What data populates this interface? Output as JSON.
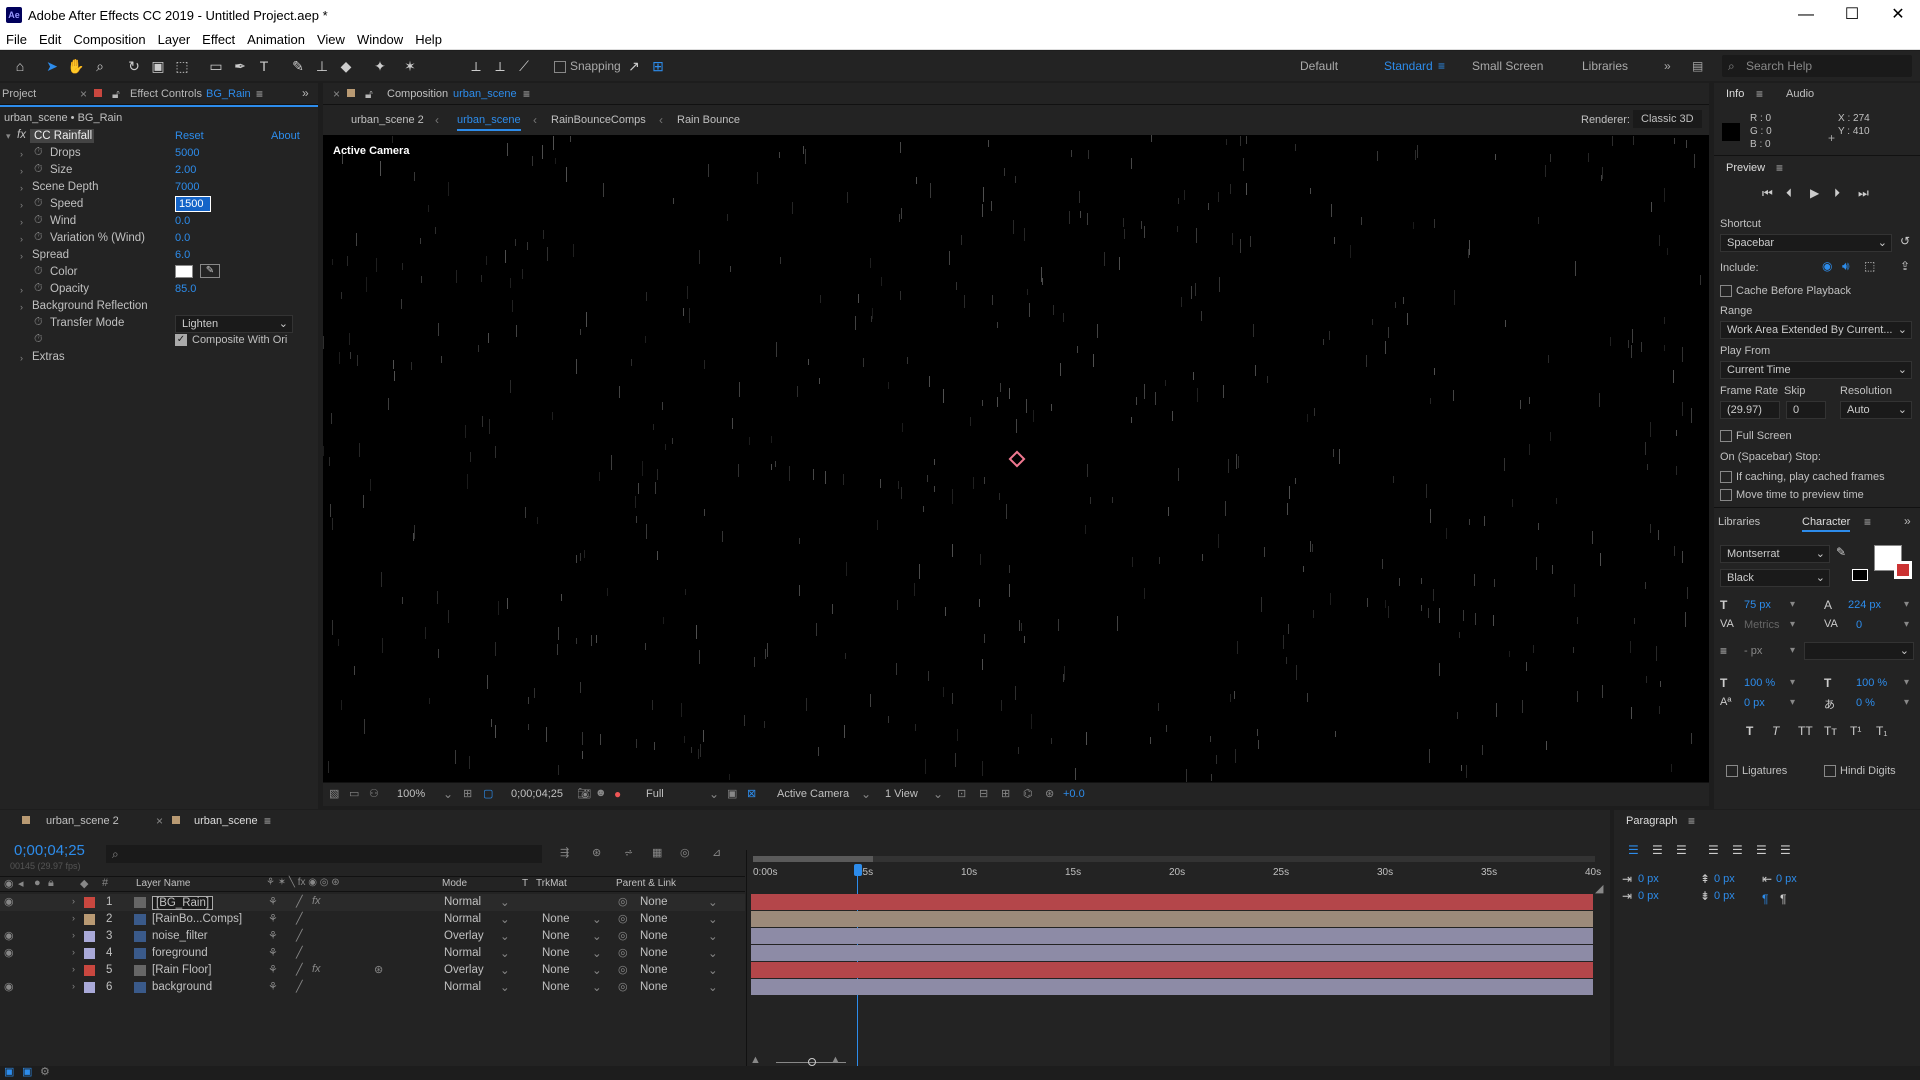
{
  "window": {
    "title": "Adobe After Effects CC 2019 - Untitled Project.aep *",
    "min": "—",
    "max": "☐",
    "close": "✕"
  },
  "menu": [
    "File",
    "Edit",
    "Composition",
    "Layer",
    "Effect",
    "Animation",
    "View",
    "Window",
    "Help"
  ],
  "toolbar": {
    "snapping": "Snapping",
    "workspaces": [
      "Default",
      "Standard",
      "Small Screen",
      "Libraries"
    ],
    "search": "Search Help"
  },
  "left_panel": {
    "tab_project": "Project",
    "tab_effect": "Effect Controls",
    "effect_layer": "BG_Rain",
    "subtitle": "urban_scene • BG_Rain",
    "fx_name": "CC Rainfall",
    "reset": "Reset",
    "about": "About",
    "props": [
      {
        "name": "Drops",
        "value": "5000"
      },
      {
        "name": "Size",
        "value": "2.00"
      },
      {
        "name": "Scene Depth",
        "value": "7000"
      },
      {
        "name": "Speed",
        "value": "1500"
      },
      {
        "name": "Wind",
        "value": "0.0"
      },
      {
        "name": "Variation % (Wind)",
        "value": "0.0"
      },
      {
        "name": "Spread",
        "value": "6.0"
      },
      {
        "name": "Color",
        "value": ""
      },
      {
        "name": "Opacity",
        "value": "85.0"
      },
      {
        "name": "Background Reflection",
        "value": ""
      },
      {
        "name": "Transfer Mode",
        "value": "Lighten"
      },
      {
        "name": "",
        "value": "Composite With Ori"
      },
      {
        "name": "Extras",
        "value": ""
      }
    ]
  },
  "comp_panel": {
    "tab": "Composition",
    "comp": "urban_scene",
    "breadcrumbs": [
      "urban_scene 2",
      "urban_scene",
      "RainBounceComps",
      "Rain Bounce"
    ],
    "renderer_label": "Renderer:",
    "renderer": "Classic 3D",
    "view_label": "Active Camera",
    "bottom": {
      "zoom": "100%",
      "time": "0;00;04;25",
      "res": "Full",
      "camera": "Active Camera",
      "views": "1 View",
      "exposure": "+0.0"
    }
  },
  "info": {
    "tab": "Info",
    "tab2": "Audio",
    "r": "R : 0",
    "g": "G : 0",
    "b": "B : 0",
    "x": "X : 274",
    "y": "Y : 410"
  },
  "preview": {
    "title": "Preview",
    "shortcut_label": "Shortcut",
    "shortcut": "Spacebar",
    "include": "Include:",
    "cache": "Cache Before Playback",
    "range_label": "Range",
    "range": "Work Area Extended By Current...",
    "play_from_label": "Play From",
    "play_from": "Current Time",
    "fr_label": "Frame Rate",
    "skip_label": "Skip",
    "res_label": "Resolution",
    "fr": "(29.97)",
    "skip": "0",
    "res": "Auto",
    "fullscreen": "Full Screen",
    "stop_label": "On (Spacebar) Stop:",
    "opt1": "If caching, play cached frames",
    "opt2": "Move time to preview time"
  },
  "character": {
    "tab1": "Libraries",
    "tab2": "Character",
    "font": "Montserrat",
    "style": "Black",
    "size": "75 px",
    "leading": "224 px",
    "kerning": "Metrics",
    "tracking": "0",
    "stroke": "- px",
    "vscale": "100 %",
    "hscale": "100 %",
    "baseline": "0 px",
    "tsume": "0 %",
    "ligatures": "Ligatures",
    "hindi": "Hindi Digits",
    "styles": [
      "T",
      "T",
      "TT",
      "Tт",
      "T¹",
      "T₁"
    ]
  },
  "paragraph": {
    "title": "Paragraph",
    "v1": "0 px",
    "v2": "0 px",
    "v3": "0 px",
    "v4": "0 px",
    "v5": "0 px"
  },
  "timeline": {
    "tabs": [
      "urban_scene 2",
      "urban_scene"
    ],
    "timecode": "0;00;04;25",
    "fps": "00145 (29.97 fps)",
    "cols": {
      "name": "Layer Name",
      "mode": "Mode",
      "t": "T",
      "trkmat": "TrkMat",
      "parent": "Parent & Link"
    },
    "ruler": [
      "0:00s",
      "05s",
      "10s",
      "15s",
      "20s",
      "25s",
      "30s",
      "35s",
      "40s"
    ],
    "layers": [
      {
        "num": "1",
        "name": "[BG_Rain]",
        "mode": "Normal",
        "trk": "",
        "parent": "None",
        "color": "#c9473f",
        "bar": "#b4464a"
      },
      {
        "num": "2",
        "name": "[RainBo...Comps]",
        "mode": "Normal",
        "trk": "None",
        "parent": "None",
        "color": "#b99a73",
        "bar": "#9c8a7a"
      },
      {
        "num": "3",
        "name": "noise_filter",
        "mode": "Overlay",
        "trk": "None",
        "parent": "None",
        "color": "#a9a9d8",
        "bar": "#8d8ba6"
      },
      {
        "num": "4",
        "name": "foreground",
        "mode": "Normal",
        "trk": "None",
        "parent": "None",
        "color": "#a9a9d8",
        "bar": "#8d8ba6"
      },
      {
        "num": "5",
        "name": "[Rain Floor]",
        "mode": "Overlay",
        "trk": "None",
        "parent": "None",
        "color": "#c9473f",
        "bar": "#b4464a"
      },
      {
        "num": "6",
        "name": "background",
        "mode": "Normal",
        "trk": "None",
        "parent": "None",
        "color": "#a9a9d8",
        "bar": "#8d8ba6"
      }
    ]
  }
}
